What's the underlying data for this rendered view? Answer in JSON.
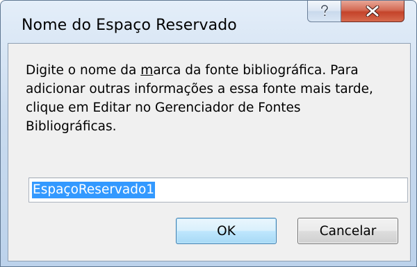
{
  "dialog": {
    "title": "Nome do Espaço Reservado",
    "message_lines": [
      "Digite o nome da ",
      "m",
      "arca da fonte bibliográfica. Para",
      "adicionar outras informações a essa fonte mais tarde,",
      "clique em Editar no Gerenciador de Fontes",
      "Bibliográficas."
    ],
    "input_value": "EspaçoReservado1",
    "ok_label": "OK",
    "cancel_label": "Cancelar"
  },
  "colors": {
    "selection": "#3399ff",
    "close_button": "#c4432a",
    "dialog_face": "#f0f0f0"
  },
  "icons": {
    "help": "help-icon",
    "close": "close-icon"
  }
}
